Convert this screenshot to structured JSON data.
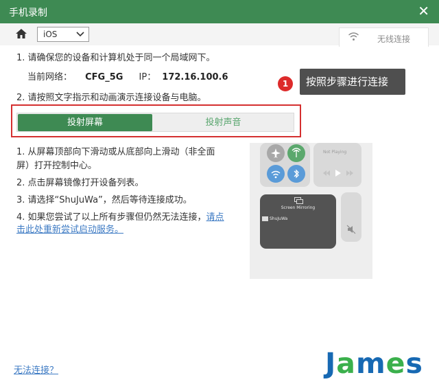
{
  "window": {
    "title": "手机录制",
    "close_glyph": "✕"
  },
  "toolbar": {
    "platform_value": "iOS",
    "wifi_tab_label": "无线连接"
  },
  "steps": {
    "step1": "1. 请确保您的设备和计算机处于同一个局域网下。",
    "network_label": "当前网络：",
    "network_value": "CFG_5G",
    "ip_label": "IP：",
    "ip_value": "172.16.100.6",
    "step2": "2. 请按照文字指示和动画演示连接设备与电脑。"
  },
  "callout": {
    "number": "1",
    "text": "按照步骤进行连接"
  },
  "mode_tabs": {
    "screen": "投射屏幕",
    "audio": "投射声音"
  },
  "instructions": {
    "i1_line1": "1. 从屏幕顶部向下滑动或从底部向上滑动（非全面",
    "i1_line2": "屏）打开控制中心。",
    "i2": "2. 点击屏幕镜像打开设备列表。",
    "i3": "3. 请选择“ShuJuWa”，然后等待连接成功。",
    "i4_line1_text": "4. 如果您尝试了以上所有步骤但仍然无法连接，",
    "i4_line1_link": "请点",
    "i4_line2_link": "击此处重新尝试启动服务。"
  },
  "phone": {
    "mirroring_title": "Screen Mirroring",
    "device_name": "ShuJuWa",
    "music_label": "Not Playing"
  },
  "footer": {
    "help_link": "无法连接？"
  },
  "watermark": {
    "text": "James"
  },
  "colors": {
    "brand_green": "#3e8a53",
    "highlight_red": "#d42f2f",
    "link_blue": "#3e7bc4"
  }
}
